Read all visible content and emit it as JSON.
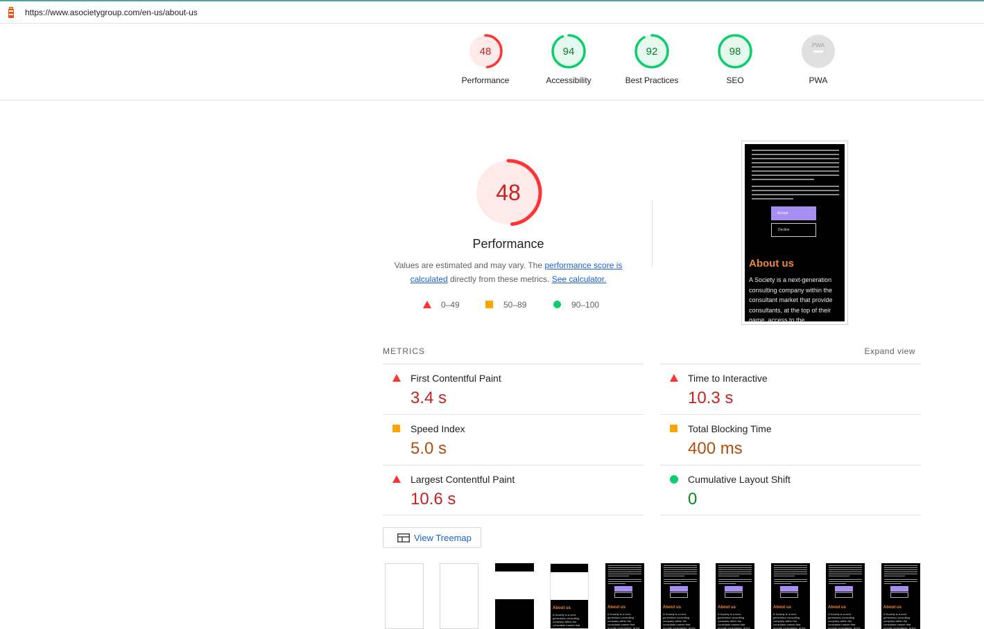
{
  "browser": {
    "url": "https://www.asocietygroup.com/en-us/about-us"
  },
  "colors": {
    "fail": "#ff3333",
    "average": "#ffa400",
    "pass": "#0cce6b",
    "link": "#1a5fd6"
  },
  "categories": [
    {
      "score": "48",
      "label": "Performance",
      "status": "fail"
    },
    {
      "score": "94",
      "label": "Accessibility",
      "status": "pass"
    },
    {
      "score": "92",
      "label": "Best Practices",
      "status": "pass"
    },
    {
      "score": "98",
      "label": "SEO",
      "status": "pass"
    },
    {
      "score": "PWA",
      "label": "PWA",
      "status": "na"
    }
  ],
  "performance": {
    "score": "48",
    "title": "Performance",
    "desc_prefix": "Values are estimated and may vary. The ",
    "link1": "performance score is calculated",
    "desc_mid": " directly from these metrics. ",
    "link2": "See calculator.",
    "legend": [
      {
        "icon": "triangle-icon",
        "range": "0–49"
      },
      {
        "icon": "square-icon",
        "range": "50–89"
      },
      {
        "icon": "circle-icon",
        "range": "90–100"
      }
    ]
  },
  "screenshot": {
    "accept": "Accept",
    "decline": "Decline",
    "heading": "About us",
    "body": "A Society is a next-generation consulting company within the consultant market that provide consultants, at the top of their game, access to the"
  },
  "metrics": {
    "header": "METRICS",
    "expand": "Expand view",
    "left": [
      {
        "name": "First Contentful Paint",
        "value": "3.4 s",
        "status": "fail"
      },
      {
        "name": "Speed Index",
        "value": "5.0 s",
        "status": "average"
      },
      {
        "name": "Largest Contentful Paint",
        "value": "10.6 s",
        "status": "fail"
      }
    ],
    "right": [
      {
        "name": "Time to Interactive",
        "value": "10.3 s",
        "status": "fail"
      },
      {
        "name": "Total Blocking Time",
        "value": "400 ms",
        "status": "average"
      },
      {
        "name": "Cumulative Layout Shift",
        "value": "0",
        "status": "pass"
      }
    ]
  },
  "treemap": {
    "label": "View Treemap"
  },
  "filmstrip": {
    "thumb_heading": "About us",
    "thumb_body": "A Society is a next-generation consulting company within the consultant market that provide consultants, at the top"
  }
}
